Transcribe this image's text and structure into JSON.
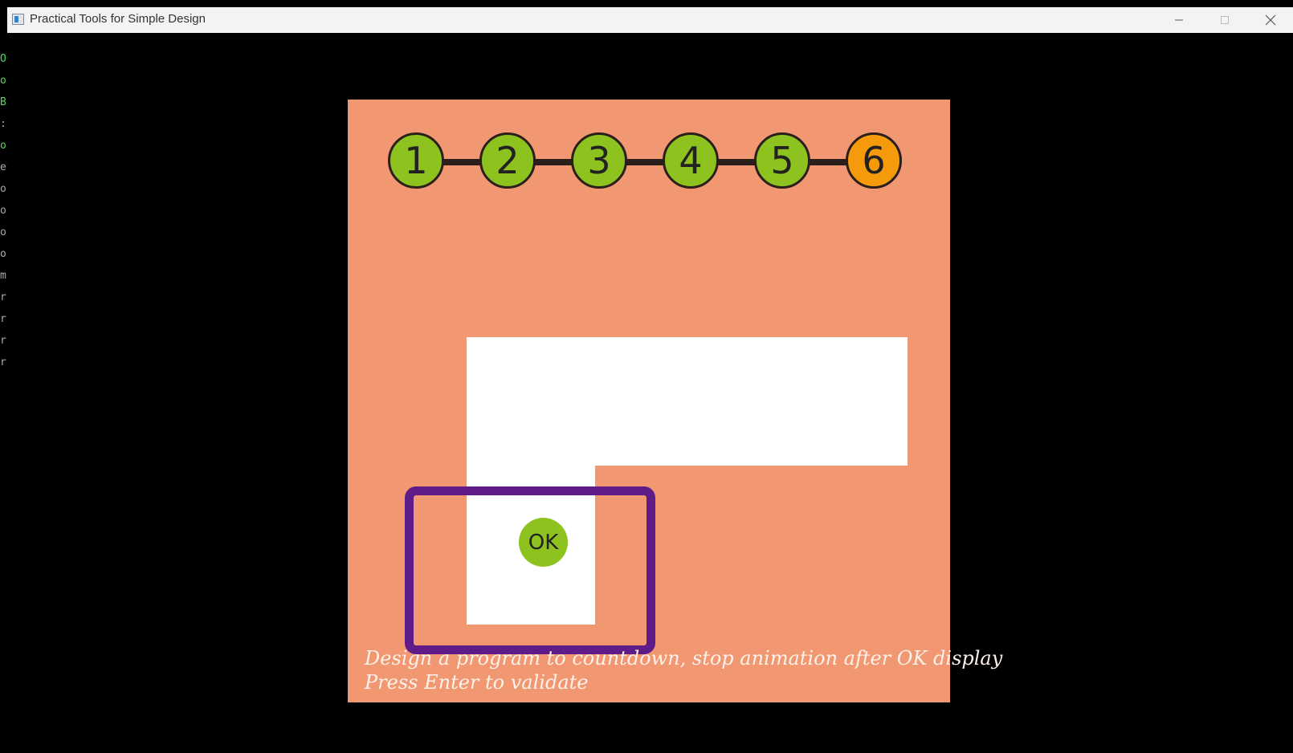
{
  "window": {
    "title": "Practical Tools for Simple Design",
    "minimize_glyph": "─",
    "maximize_glyph": "☐",
    "close_glyph": "✕"
  },
  "background_strip": [
    "OC",
    "os",
    "B:",
    ":",
    "ol",
    "et",
    "or",
    "or",
    "or",
    "or",
    "m",
    "rl",
    "rl",
    "rl",
    "rl"
  ],
  "stepper": {
    "steps": [
      {
        "label": "1",
        "state": "done"
      },
      {
        "label": "2",
        "state": "done"
      },
      {
        "label": "3",
        "state": "done"
      },
      {
        "label": "4",
        "state": "done"
      },
      {
        "label": "5",
        "state": "done"
      },
      {
        "label": "6",
        "state": "current"
      }
    ],
    "colors": {
      "done": "#8ec21e",
      "current": "#f59a0a",
      "line": "#2a1f1b"
    }
  },
  "canvas": {
    "background": "#f19872",
    "ok_label": "OK",
    "selection_color": "#5f1b87"
  },
  "instructions": {
    "line1": "Design a program to countdown, stop animation after OK display",
    "line2": "Press Enter to validate"
  }
}
